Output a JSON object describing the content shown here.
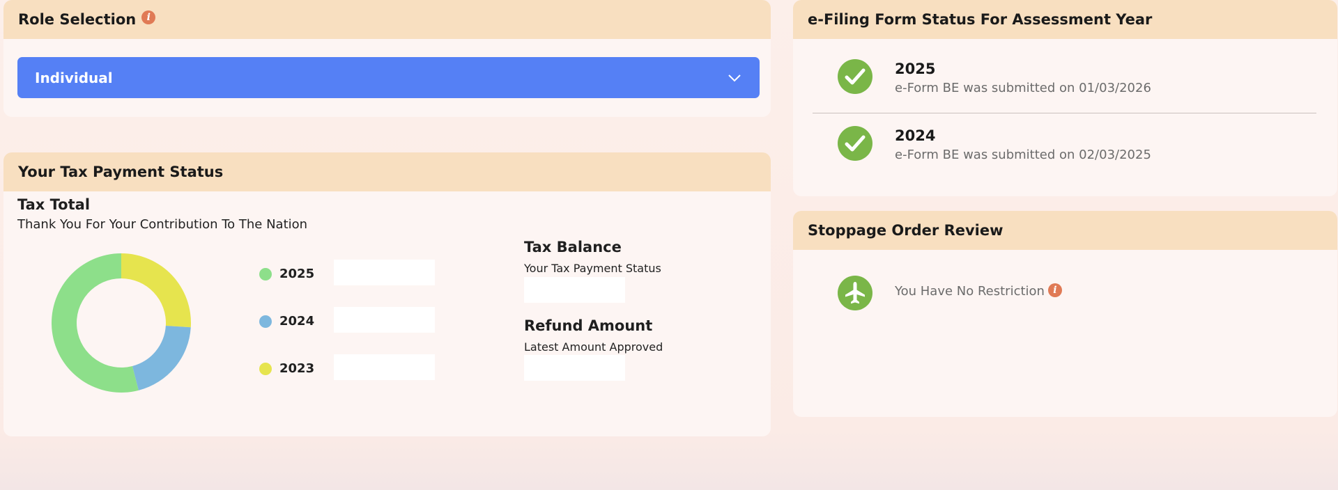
{
  "role": {
    "title": "Role Selection",
    "info_icon": "info-icon",
    "selected": "Individual",
    "accent": "#5580f5"
  },
  "tax": {
    "title": "Your Tax Payment Status",
    "total_title": "Tax Total",
    "total_sub": "Thank You For Your Contribution To The Nation",
    "legend": [
      {
        "label": "2025",
        "color": "#8ddf8a"
      },
      {
        "label": "2024",
        "color": "#7db7de"
      },
      {
        "label": "2023",
        "color": "#e6e44e"
      }
    ],
    "balance_title": "Tax Balance",
    "balance_sub": "Your Tax Payment Status",
    "refund_title": "Refund Amount",
    "refund_sub": "Latest Amount Approved"
  },
  "chart_data": {
    "type": "pie",
    "categories": [
      "2025",
      "2024",
      "2023"
    ],
    "values": [
      54,
      20,
      26
    ],
    "colors": [
      "#8ddf8a",
      "#7db7de",
      "#e6e44e"
    ]
  },
  "efiling": {
    "title": "e-Filing Form Status For Assessment Year",
    "items": [
      {
        "year": "2025",
        "text": "e-Form BE was submitted on 01/03/2026",
        "icon": "check-circle-icon"
      },
      {
        "year": "2024",
        "text": "e-Form BE was submitted on 02/03/2025",
        "icon": "check-circle-icon"
      }
    ],
    "status_color": "#7ab648"
  },
  "stoppage": {
    "title": "Stoppage Order Review",
    "text": "You Have No Restriction",
    "icon": "airplane-icon"
  }
}
